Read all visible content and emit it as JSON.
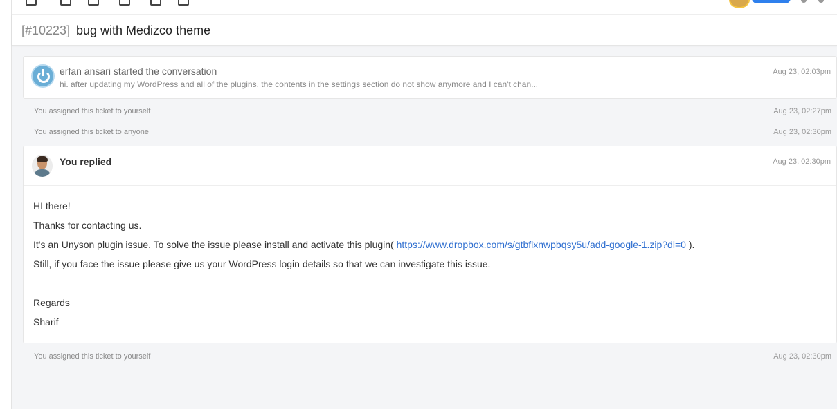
{
  "ticket": {
    "id": "[#10223]",
    "title": "bug with Medizco theme"
  },
  "conversation_start": {
    "author_line": "erfan ansari started the conversation",
    "preview": "hi. after updating my WordPress and all of the plugins, the contents in the settings section do not show anymore and I can't chan...",
    "time": "Aug 23, 02:03pm"
  },
  "events_before": [
    {
      "text": "You assigned this ticket to yourself",
      "time": "Aug 23, 02:27pm"
    },
    {
      "text": "You assigned this ticket to anyone",
      "time": "Aug 23, 02:30pm"
    }
  ],
  "reply": {
    "author": "You replied",
    "time": "Aug 23, 02:30pm",
    "greeting": "HI there!",
    "thanks": "Thanks for contacting us.",
    "issue_prefix": "It's an Unyson plugin issue. To solve the issue please install and activate this plugin(",
    "issue_link": "https://www.dropbox.com/s/gtbflxnwpbqsy5u/add-google-1.zip?dl=0",
    "issue_suffix": ").",
    "followup": "Still, if you face the issue please give us your WordPress login details so that we can investigate this issue.",
    "regards": "Regards",
    "signature": "Sharif"
  },
  "events_after": [
    {
      "text": "You assigned this ticket to yourself",
      "time": "Aug 23, 02:30pm"
    }
  ],
  "colors": {
    "link": "#2f6fd0",
    "primary_button": "#2f80ed",
    "avatar_ring": "#6aaed6"
  }
}
